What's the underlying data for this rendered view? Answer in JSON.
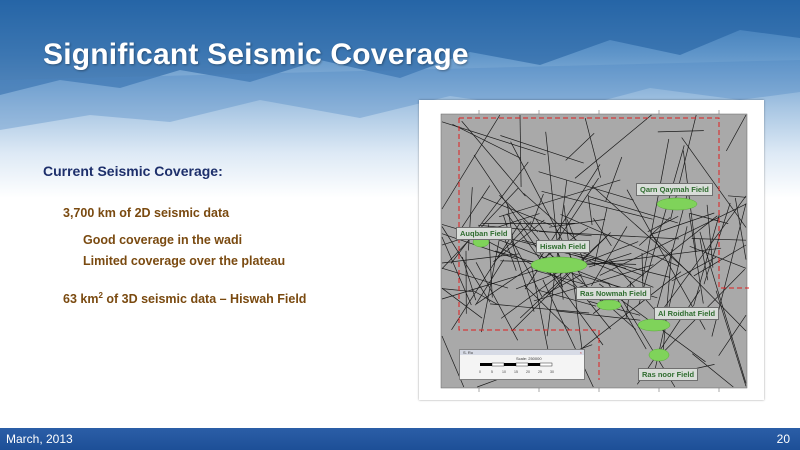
{
  "slide": {
    "title": "Significant Seismic Coverage",
    "heading": "Current  Seismic Coverage:",
    "bullets": {
      "seismic_2d": "3,700 km of 2D seismic data",
      "wadi": "Good coverage in the wadi",
      "plateau": "Limited coverage over the plateau",
      "seismic_3d_prefix": "63 km",
      "seismic_3d_sup": "2",
      "seismic_3d_suffix": " of 3D seismic data – Hiswah Field"
    }
  },
  "map": {
    "fields": {
      "qarn_qaymah": "Qarn Qaymah Field",
      "auqban": "Auqban Field",
      "hiswah": "Hiswah Field",
      "ras_nowmah": "Ras Nowmah Field",
      "al_roidhat": "Al Roidhat Field",
      "ras_noor": "Ras noor Field"
    },
    "colors": {
      "background": "#a9a9a9",
      "lines": "#1a1a1a",
      "boundary": "#e02020",
      "field": "#7fd35a"
    },
    "scale_dialog": {
      "title": "S. Ro",
      "scale": "Scale: 250000",
      "close": "×",
      "ticks": [
        "0",
        "5",
        "10",
        "15",
        "20",
        "25",
        "30"
      ]
    }
  },
  "footer": {
    "date": "March, 2013",
    "page": "20"
  }
}
